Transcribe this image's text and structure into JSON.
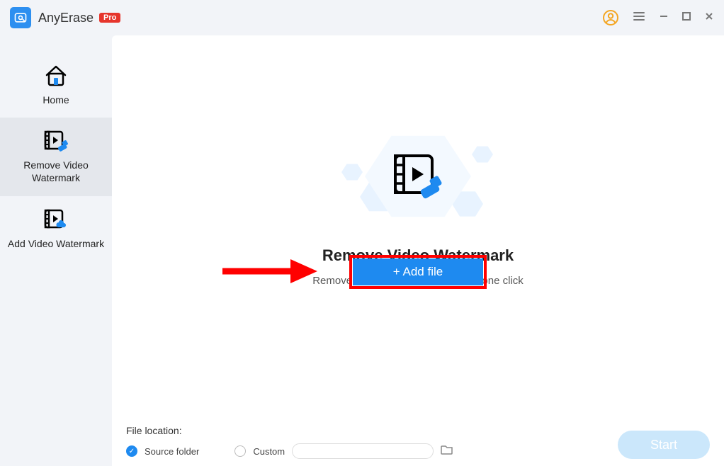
{
  "header": {
    "app_name": "AnyErase",
    "badge": "Pro"
  },
  "sidebar": {
    "items": [
      {
        "label": "Home"
      },
      {
        "label": "Remove Video Watermark"
      },
      {
        "label": "Add Video Watermark"
      }
    ]
  },
  "main": {
    "title": "Remove Video Watermark",
    "subtitle": "Remove watermark from video with one click",
    "add_file_label": "+ Add file"
  },
  "bottom": {
    "file_location_label": "File location:",
    "source_folder_label": "Source folder",
    "custom_label": "Custom",
    "start_label": "Start"
  }
}
